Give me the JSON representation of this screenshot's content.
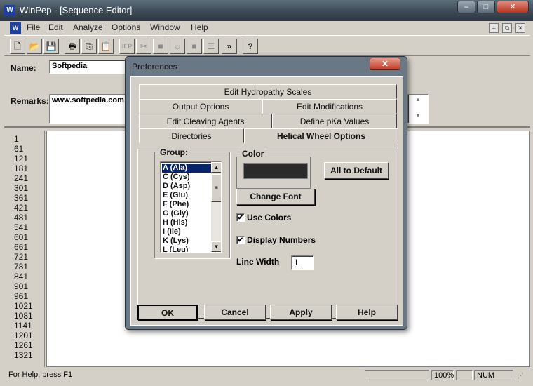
{
  "window": {
    "title": "WinPep - [Sequence Editor]",
    "icon_name": "winpep-app-icon",
    "controls": [
      "–",
      "□",
      "✕"
    ]
  },
  "menu": {
    "items": [
      "File",
      "Edit",
      "Analyze",
      "Options",
      "Window",
      "Help"
    ],
    "mdi_controls": [
      "–",
      "⧉",
      "✕"
    ]
  },
  "toolbar": {
    "buttons": [
      "new-file-icon",
      "open-folder-icon",
      "save-icon",
      "print-icon",
      "copy-icon",
      "paste-icon",
      "iep-icon",
      "cut-icon",
      "stop-icon",
      "sun-icon",
      "square-icon",
      "lines-icon",
      "forward-icon",
      "help-icon"
    ],
    "glyphs": [
      "🗋",
      "📂",
      "💾",
      "🖶",
      "⎘",
      "📋",
      "IEP",
      "✂",
      "■",
      "☼",
      "■",
      "☰",
      "»",
      "?"
    ]
  },
  "editor": {
    "name_label": "Name:",
    "name_value": "Softpedia",
    "remarks_label": "Remarks:",
    "remarks_value": "www.softpedia.com",
    "line_numbers": [
      "1",
      "61",
      "121",
      "181",
      "241",
      "301",
      "361",
      "421",
      "481",
      "541",
      "601",
      "661",
      "721",
      "781",
      "841",
      "901",
      "961",
      "1021",
      "1081",
      "1141",
      "1201",
      "1261",
      "1321"
    ]
  },
  "status": {
    "help_text": "For Help, press F1",
    "zoom": "100%",
    "num": "NUM"
  },
  "dialog": {
    "title": "Preferences",
    "close": "✕",
    "tabs_row1": [
      "Edit Hydropathy Scales"
    ],
    "tabs_row2": [
      "Output Options",
      "Edit Modifications"
    ],
    "tabs_row3": [
      "Edit Cleaving Agents",
      "Define pKa Values"
    ],
    "tabs_row4": [
      "Directories",
      "Helical Wheel Options"
    ],
    "active_tab": "Helical Wheel Options",
    "group_label": "Group:",
    "groups": [
      "A (Ala)",
      "C (Cys)",
      "D (Asp)",
      "E (Glu)",
      "F (Phe)",
      "G (Gly)",
      "H (His)",
      "I (Ile)",
      "K (Lys)",
      "L (Leu)"
    ],
    "selected_group": "A (Ala)",
    "color_label": "Color",
    "swatch_color": "#2a2a2a",
    "all_default": "All to Default",
    "change_font": "Change Font",
    "use_colors": {
      "label": "Use Colors",
      "checked": true
    },
    "display_numbers": {
      "label": "Display Numbers",
      "checked": true
    },
    "line_width_label": "Line Width",
    "line_width_value": "1",
    "buttons": {
      "ok": "OK",
      "cancel": "Cancel",
      "apply": "Apply",
      "help": "Help"
    }
  }
}
